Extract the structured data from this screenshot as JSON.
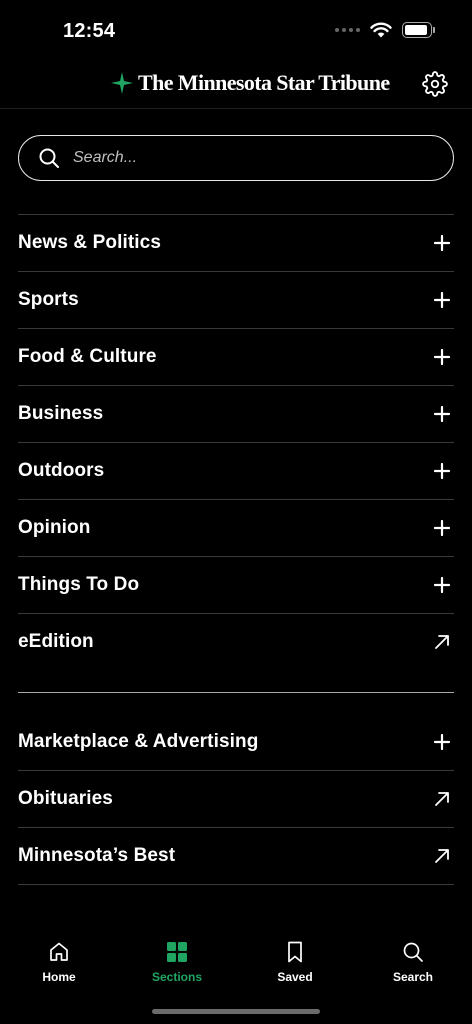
{
  "status": {
    "time": "12:54"
  },
  "header": {
    "title": "The Minnesota Star Tribune",
    "logo_icon": "star-logo-icon",
    "settings_icon": "gear-icon",
    "brand_color": "#1fa561"
  },
  "search": {
    "placeholder": "Search...",
    "value": ""
  },
  "sections": {
    "primary": [
      {
        "label": "News & Politics",
        "icon": "plus-icon"
      },
      {
        "label": "Sports",
        "icon": "plus-icon"
      },
      {
        "label": "Food & Culture",
        "icon": "plus-icon"
      },
      {
        "label": "Business",
        "icon": "plus-icon"
      },
      {
        "label": "Outdoors",
        "icon": "plus-icon"
      },
      {
        "label": "Opinion",
        "icon": "plus-icon"
      },
      {
        "label": "Things To Do",
        "icon": "plus-icon"
      },
      {
        "label": "eEdition",
        "icon": "external-arrow-icon"
      }
    ],
    "secondary": [
      {
        "label": "Marketplace & Advertising",
        "icon": "plus-icon"
      },
      {
        "label": "Obituaries",
        "icon": "external-arrow-icon"
      },
      {
        "label": "Minnesota’s Best",
        "icon": "external-arrow-icon"
      }
    ]
  },
  "tabbar": {
    "items": [
      {
        "label": "Home",
        "icon": "home-icon",
        "active": false
      },
      {
        "label": "Sections",
        "icon": "grid-icon",
        "active": true
      },
      {
        "label": "Saved",
        "icon": "bookmark-icon",
        "active": false
      },
      {
        "label": "Search",
        "icon": "search-icon",
        "active": false
      }
    ],
    "active_color": "#1fa561"
  }
}
